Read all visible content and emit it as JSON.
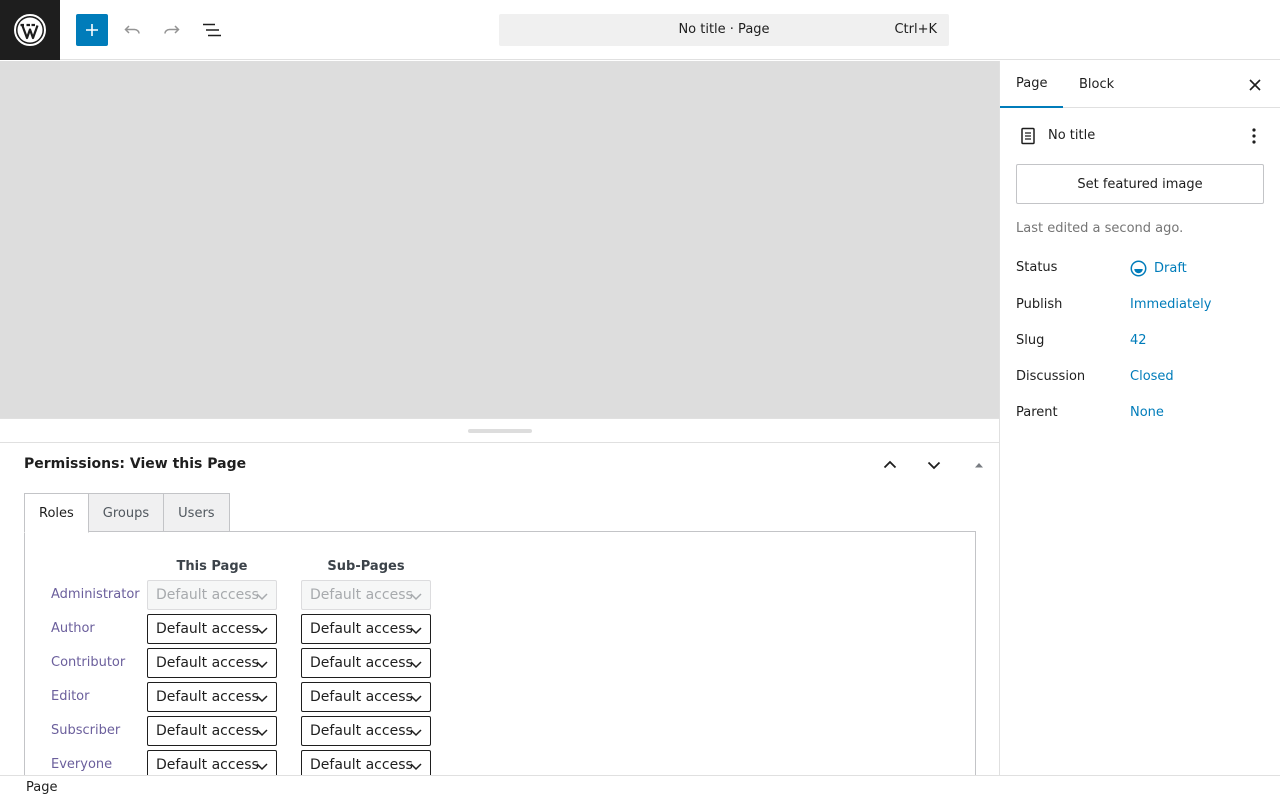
{
  "header": {
    "command_bar": {
      "title": "No title · Page",
      "shortcut": "Ctrl+K"
    },
    "icons": [
      "wordpress-logo",
      "plus-icon",
      "undo-icon",
      "redo-icon",
      "document-overview-icon"
    ]
  },
  "colors": {
    "accent": "#007cba",
    "logo_bg": "#1e1e1e",
    "canvas_bg": "#dddddd"
  },
  "metabox": {
    "title": "Permissions: View this Page",
    "tabs": [
      {
        "label": "Roles",
        "active": true
      },
      {
        "label": "Groups",
        "active": false
      },
      {
        "label": "Users",
        "active": false
      }
    ],
    "columns": {
      "this_page": "This Page",
      "sub_pages": "Sub-Pages"
    },
    "rows": [
      {
        "role": "Administrator",
        "this_page": "Default access",
        "sub_pages": "Default access",
        "disabled": true
      },
      {
        "role": "Author",
        "this_page": "Default access",
        "sub_pages": "Default access",
        "disabled": false
      },
      {
        "role": "Contributor",
        "this_page": "Default access",
        "sub_pages": "Default access",
        "disabled": false
      },
      {
        "role": "Editor",
        "this_page": "Default access",
        "sub_pages": "Default access",
        "disabled": false
      },
      {
        "role": "Subscriber",
        "this_page": "Default access",
        "sub_pages": "Default access",
        "disabled": false
      },
      {
        "role": "Everyone",
        "this_page": "Default access",
        "sub_pages": "Default access",
        "disabled": false
      }
    ]
  },
  "sidebar": {
    "tabs": {
      "page": "Page",
      "block": "Block"
    },
    "doc_title": "No title",
    "featured_image": "Set featured image",
    "last_edited": "Last edited a second ago.",
    "props": [
      {
        "label": "Status",
        "value": "Draft"
      },
      {
        "label": "Publish",
        "value": "Immediately"
      },
      {
        "label": "Slug",
        "value": "42"
      },
      {
        "label": "Discussion",
        "value": "Closed"
      },
      {
        "label": "Parent",
        "value": "None"
      }
    ]
  },
  "footer": {
    "breadcrumb": "Page"
  }
}
